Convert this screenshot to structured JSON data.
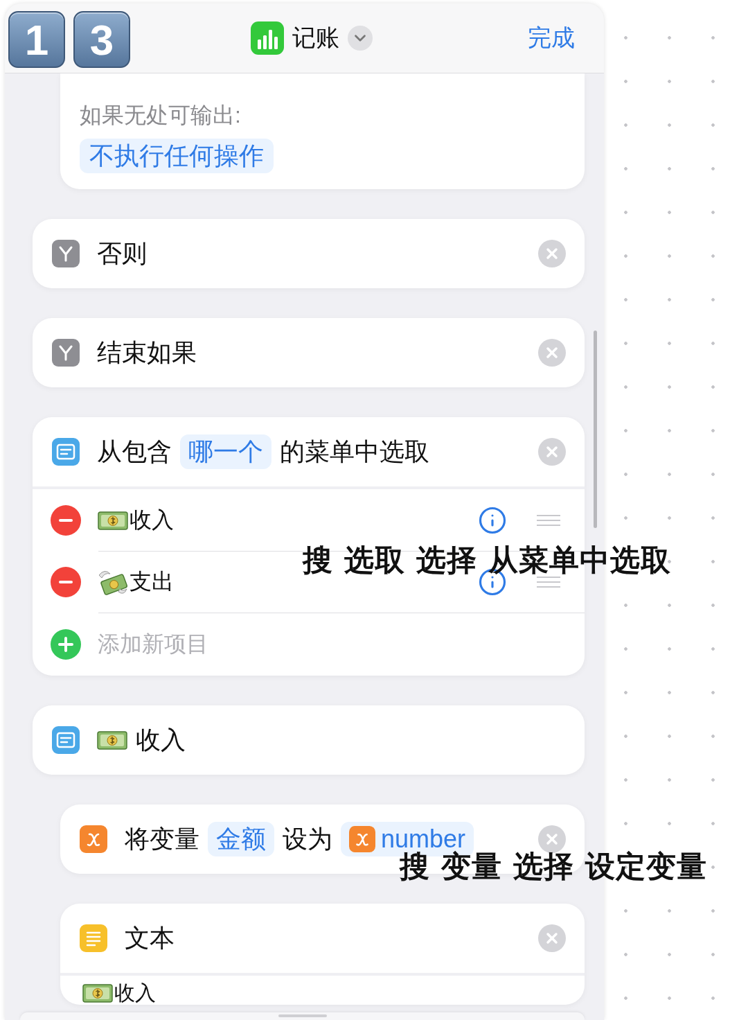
{
  "badges": [
    "1",
    "3"
  ],
  "header": {
    "app_name": "记账",
    "done": "完成"
  },
  "cards": [
    {
      "kind": "output",
      "nested": true,
      "label": "如果无处可输出:",
      "chip": "不执行任何操作"
    },
    {
      "kind": "control",
      "nested": false,
      "title": [
        {
          "kind": "text",
          "text": "否则"
        }
      ]
    },
    {
      "kind": "control",
      "nested": false,
      "title": [
        {
          "kind": "text",
          "text": "结束如果"
        }
      ]
    },
    {
      "kind": "menu",
      "nested": false,
      "title": [
        {
          "kind": "text",
          "text": "从包含"
        },
        {
          "kind": "token",
          "text": "哪一个"
        },
        {
          "kind": "text",
          "text": "的菜单中选取"
        }
      ],
      "items": [
        {
          "label": "收入"
        },
        {
          "label": "支出"
        }
      ],
      "add": "添加新项目"
    },
    {
      "kind": "case",
      "nested": false,
      "title": [
        {
          "kind": "text",
          "text": "收入"
        }
      ]
    },
    {
      "kind": "variable",
      "nested": true,
      "title": [
        {
          "kind": "text",
          "text": "将变量"
        },
        {
          "kind": "token",
          "text": "金额"
        },
        {
          "kind": "text",
          "text": "设为"
        },
        {
          "kind": "var_token",
          "text": "number"
        }
      ]
    },
    {
      "kind": "text",
      "nested": true,
      "title": [
        {
          "kind": "text",
          "text": "文本"
        }
      ],
      "body": "收入"
    }
  ],
  "annotations": [
    "搜 选取 选择 从菜单中选取",
    "搜 变量 选择 设定变量"
  ]
}
